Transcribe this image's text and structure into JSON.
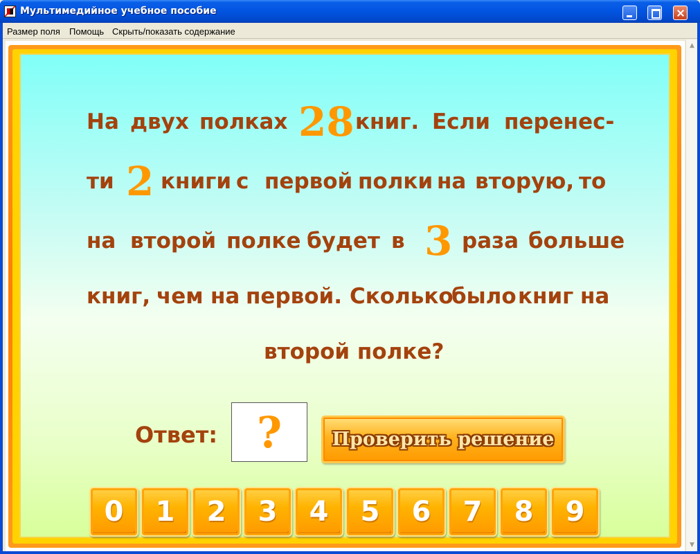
{
  "window": {
    "title": "Мультимедийное учебное пособие"
  },
  "menu": {
    "items": [
      "Размер поля",
      "Помощь",
      "Скрыть/показать содержание"
    ]
  },
  "problem": {
    "lines": [
      [
        "На",
        "двух",
        "полках",
        "28",
        "книг.",
        "Если",
        "перенес-"
      ],
      [
        "ти",
        "2",
        "книги",
        "с",
        "первой",
        "полки",
        "на",
        "вторую,",
        "то"
      ],
      [
        "на",
        "второй",
        "полке",
        "будет",
        "в",
        "3",
        "раза",
        "больше"
      ],
      [
        "книг,",
        "чем",
        "на",
        "первой.",
        "Сколько",
        "было",
        "книг",
        "на"
      ],
      [
        "второй полке?"
      ]
    ]
  },
  "answer": {
    "label": "Ответ:",
    "value": "?"
  },
  "check_button": {
    "label": "Проверить решение"
  },
  "digits": [
    "0",
    "1",
    "2",
    "3",
    "4",
    "5",
    "6",
    "7",
    "8",
    "9"
  ],
  "colors": {
    "text": "#a4420d",
    "highlight": "#ff9800",
    "frame": "#ff7d00",
    "title_bar": "#0254e0"
  }
}
